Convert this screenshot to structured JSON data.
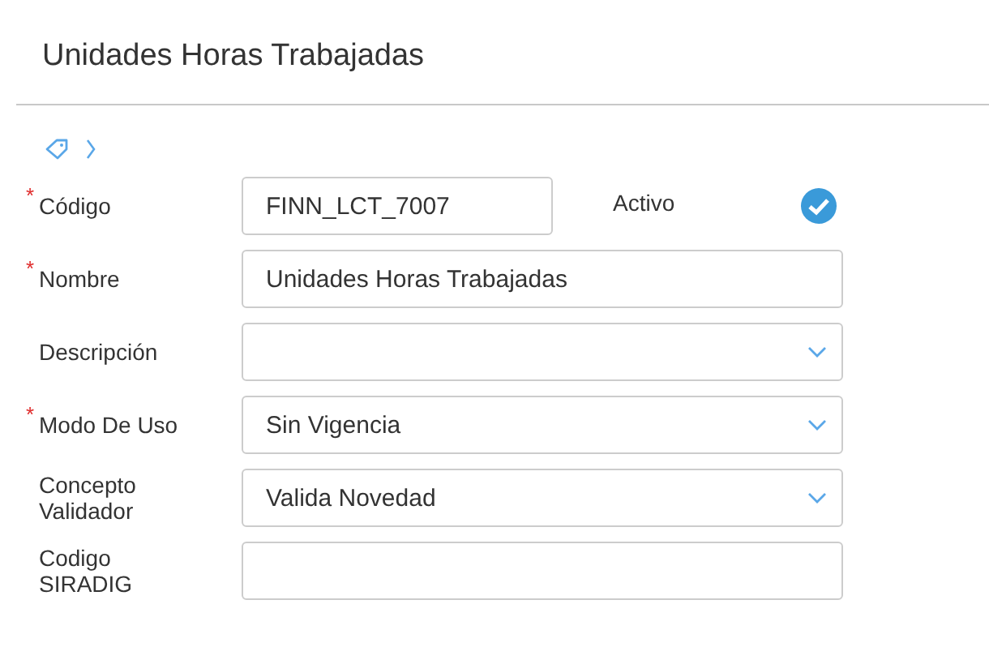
{
  "title": "Unidades Horas Trabajadas",
  "fields": [
    {
      "label": "Código",
      "required_mark": "*",
      "kind": "text",
      "value": "FINN_LCT_7007",
      "extra": {
        "label": "Activo",
        "checked": true
      }
    },
    {
      "label": "Nombre",
      "required_mark": "*",
      "kind": "text",
      "value": "Unidades Horas Trabajadas"
    },
    {
      "label": "Descripción",
      "kind": "select"
    },
    {
      "label": "Modo De Uso",
      "required_mark": "*",
      "kind": "select",
      "value": "Sin Vigencia"
    },
    {
      "label": "Concepto Validador",
      "kind": "select",
      "value": "Valida Novedad"
    },
    {
      "label": "Codigo SIRADIG",
      "kind": "text"
    }
  ]
}
